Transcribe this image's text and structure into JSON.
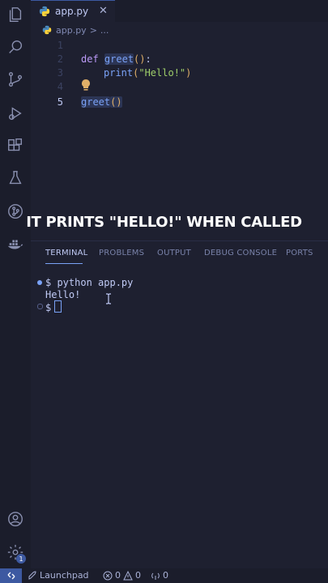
{
  "tab": {
    "filename": "app.py",
    "close": "✕"
  },
  "breadcrumb": {
    "file": "app.py",
    "sep": ">",
    "more": "..."
  },
  "editor": {
    "lines": [
      {
        "num": "1"
      },
      {
        "num": "2",
        "kw": "def",
        "fn": "greet",
        "parens": "()",
        "rest": ":"
      },
      {
        "num": "3",
        "fn": "print",
        "open": "(",
        "str": "\"Hello!\"",
        "close": ")"
      },
      {
        "num": "4"
      },
      {
        "num": "5",
        "fn": "greet",
        "parens": "()"
      }
    ]
  },
  "caption": "IT PRINTS \"HELLO!\" WHEN CALLED",
  "panel": {
    "tabs": [
      "TERMINAL",
      "PROBLEMS",
      "OUTPUT",
      "DEBUG CONSOLE",
      "PORTS"
    ],
    "active_tab": "TERMINAL"
  },
  "terminal": {
    "line1": "$ python app.py",
    "line2": "Hello!",
    "line3": "$"
  },
  "status_bar": {
    "launchpad": "Launchpad",
    "errors": "0",
    "warnings": "0",
    "ports": "0"
  },
  "activity_bar": {
    "badge": "1"
  },
  "colors": {
    "background": "#1e2030",
    "accent": "#3d59a1",
    "keyword": "#bb9af7",
    "function": "#7aa2f7",
    "string": "#9ece6a"
  }
}
